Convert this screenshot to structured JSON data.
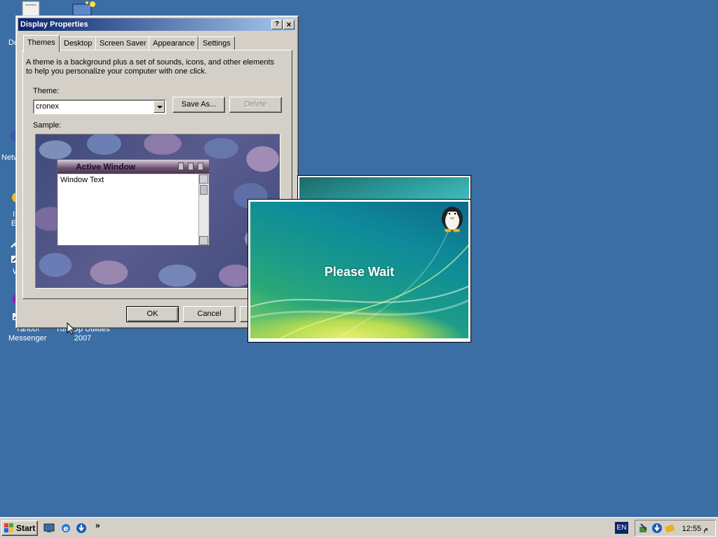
{
  "desktop": {
    "icons": [
      {
        "label": "Do"
      },
      {
        "label": "Netw"
      },
      {
        "label": "I\nE"
      },
      {
        "label": "W"
      },
      {
        "label": "Yahoo!\nMessenger"
      },
      {
        "label": "TuneUp Utilities\n2007"
      }
    ]
  },
  "dialog": {
    "title": "Display Properties",
    "help_label": "?",
    "close_label": "×",
    "tabs": [
      {
        "label": "Themes"
      },
      {
        "label": "Desktop"
      },
      {
        "label": "Screen Saver"
      },
      {
        "label": "Appearance"
      },
      {
        "label": "Settings"
      }
    ],
    "description": "A theme is a background plus a set of sounds, icons, and other elements to help you personalize your computer with one click.",
    "theme_label": "Theme:",
    "theme_value": "cronex",
    "save_as_label": "Save As...",
    "delete_label": "Delete",
    "sample_label": "Sample:",
    "sample": {
      "active_window_title": "Active Window",
      "window_text": "Window Text"
    },
    "ok_label": "OK",
    "cancel_label": "Cancel"
  },
  "splash": {
    "message": "Please Wait"
  },
  "taskbar": {
    "start_label": "Start",
    "overflow_label": "»",
    "language": "EN",
    "clock": "12:55 م"
  }
}
